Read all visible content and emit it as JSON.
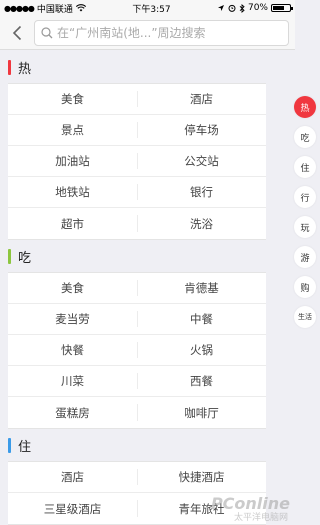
{
  "status_bar": {
    "carrier": "中国联通",
    "time": "下午3:57",
    "battery": "70%",
    "battery_level": 0.7
  },
  "search": {
    "placeholder": "在“广州南站(地...”周边搜索"
  },
  "sections": [
    {
      "title": "热",
      "color": "#f0373f",
      "rows": [
        [
          "美食",
          "酒店"
        ],
        [
          "景点",
          "停车场"
        ],
        [
          "加油站",
          "公交站"
        ],
        [
          "地铁站",
          "银行"
        ],
        [
          "超市",
          "洗浴"
        ]
      ]
    },
    {
      "title": "吃",
      "color": "#8dc63f",
      "rows": [
        [
          "美食",
          "肯德基"
        ],
        [
          "麦当劳",
          "中餐"
        ],
        [
          "快餐",
          "火锅"
        ],
        [
          "川菜",
          "西餐"
        ],
        [
          "蛋糕房",
          "咖啡厅"
        ]
      ]
    },
    {
      "title": "住",
      "color": "#3b9be8",
      "rows": [
        [
          "酒店",
          "快捷酒店"
        ],
        [
          "三星级酒店",
          "青年旅社"
        ]
      ]
    }
  ],
  "index": [
    "热",
    "吃",
    "住",
    "行",
    "玩",
    "游",
    "购",
    "生活"
  ],
  "watermark": {
    "brand": "PConline",
    "sub": "太平洋电脑网"
  }
}
